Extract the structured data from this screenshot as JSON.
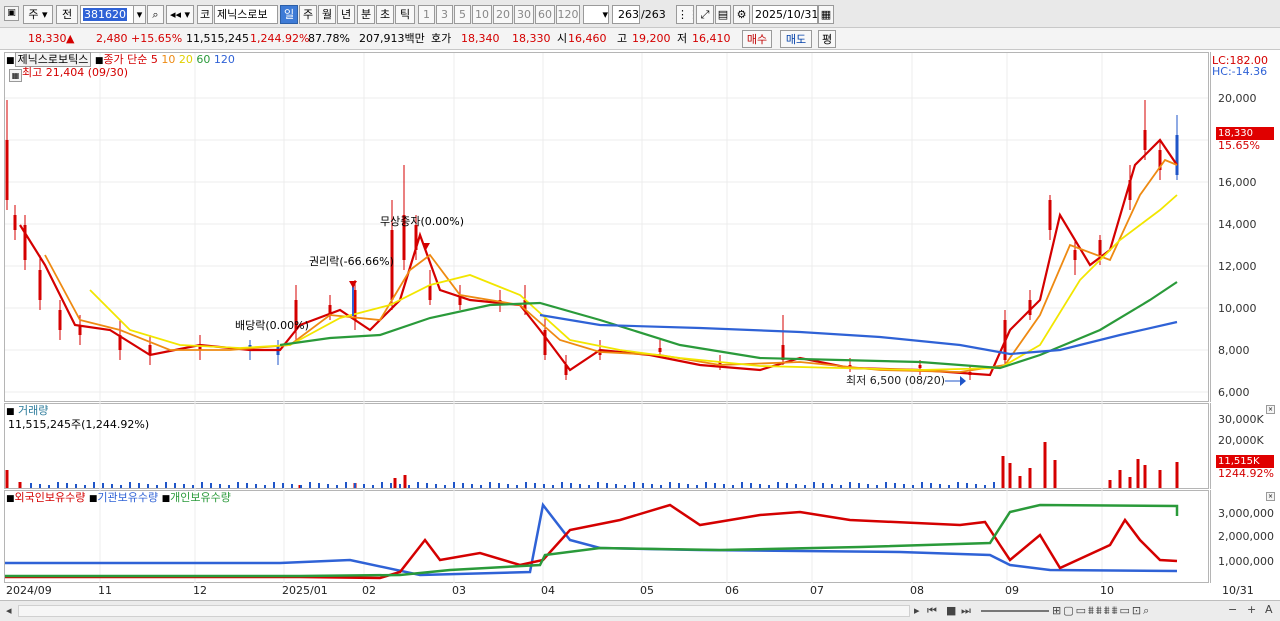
{
  "toolbar": {
    "tab_day_short": "주",
    "tab_prev": "전",
    "code": "381620",
    "ko_btn": "코",
    "name": "제닉스로보",
    "period_day": "일",
    "period_week": "주",
    "period_month": "월",
    "period_year": "년",
    "period_min": "분",
    "period_sec": "초",
    "period_tick": "틱",
    "mins": [
      "1",
      "3",
      "5",
      "10",
      "20",
      "30",
      "60",
      "120"
    ],
    "count": "263",
    "total": "/263",
    "date": "2025/10/31"
  },
  "quote": {
    "price": "18,330",
    "change": "2,480",
    "rate": "+15.65%",
    "volume": "11,515,245",
    "vol_rate": "1,244.92%",
    "pct": "87.78%",
    "amount": "207,913백만",
    "hoga_label": "호가",
    "ask": "18,340",
    "bid": "18,330",
    "open_label": "시",
    "open": "16,460",
    "high_label": "고",
    "high": "19,200",
    "low_label": "저",
    "low": "16,410",
    "buy": "매수",
    "sell": "매도",
    "flat": "평"
  },
  "price_panel": {
    "name": "제닉스로보틱스",
    "ma_title": "종가 단순",
    "ma_periods": [
      "5",
      "10",
      "20",
      "60",
      "120"
    ],
    "ma_colors": [
      "#d40000",
      "#ee8a12",
      "#f2e600",
      "#2a9a3a",
      "#2f62d6"
    ],
    "high_note": "최고 21,404 (09/30)",
    "low_note": "최저 6,500 (08/20)",
    "events": [
      "배당락(0.00%)",
      "권리락(-66.66%)",
      "무상증자(0.00%)"
    ],
    "lc": "LC:182.00",
    "hc": "HC:-14.36",
    "yticks": [
      "20,000",
      "18,000",
      "16,000",
      "14,000",
      "12,000",
      "10,000",
      "8,000",
      "6,000"
    ],
    "cur_price": "18,330",
    "cur_rate": "15.65%"
  },
  "volume_panel": {
    "title": "거래량",
    "info": "11,515,245주(1,244.92%)",
    "yticks": [
      "30,000K",
      "20,000K"
    ],
    "cur": "11,515K",
    "cur_rate": "1244.92%"
  },
  "holding_panel": {
    "series": [
      "외국인보유수량",
      "기관보유수량",
      "개인보유수량"
    ],
    "colors": [
      "#d40000",
      "#2f62d6",
      "#2a9a3a"
    ],
    "yticks": [
      "3,000,000",
      "2,000,000",
      "1,000,000"
    ]
  },
  "xaxis": {
    "labels": [
      "2024/09",
      "11",
      "12",
      "2025/01",
      "02",
      "03",
      "04",
      "05",
      "06",
      "07",
      "08",
      "09",
      "10",
      "10/31"
    ]
  }
}
